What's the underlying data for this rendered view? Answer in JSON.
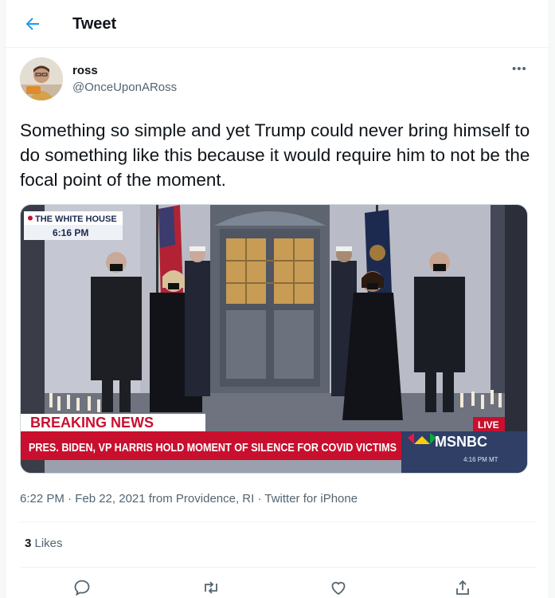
{
  "header": {
    "title": "Tweet"
  },
  "author": {
    "name": "ross",
    "handle": "@OnceUponARoss"
  },
  "tweet": {
    "text": "Something so simple and yet Trump could never bring himself to do something like this because it would require him to not be the focal point of the moment.",
    "meta": "6:22 PM · Feb 22, 2021 from Providence, RI · Twitter for iPhone",
    "likes_count": "3",
    "likes_label": " Likes"
  },
  "media": {
    "location_label": "THE WHITE HOUSE",
    "clock": "6:16 PM",
    "breaking": "BREAKING NEWS",
    "headline": "PRES. BIDEN, VP HARRIS HOLD MOMENT OF SILENCE FOR COVID VICTIMS",
    "live": "LIVE",
    "network": "MSNBC",
    "network_time": "4:16 PM MT"
  },
  "colors": {
    "accent": "#1d9bf0",
    "msnbc_red": "#c8102e",
    "text_secondary": "#536471"
  },
  "icons": [
    "back-arrow-icon",
    "more-icon",
    "reply-icon",
    "retweet-icon",
    "like-icon",
    "share-icon"
  ]
}
